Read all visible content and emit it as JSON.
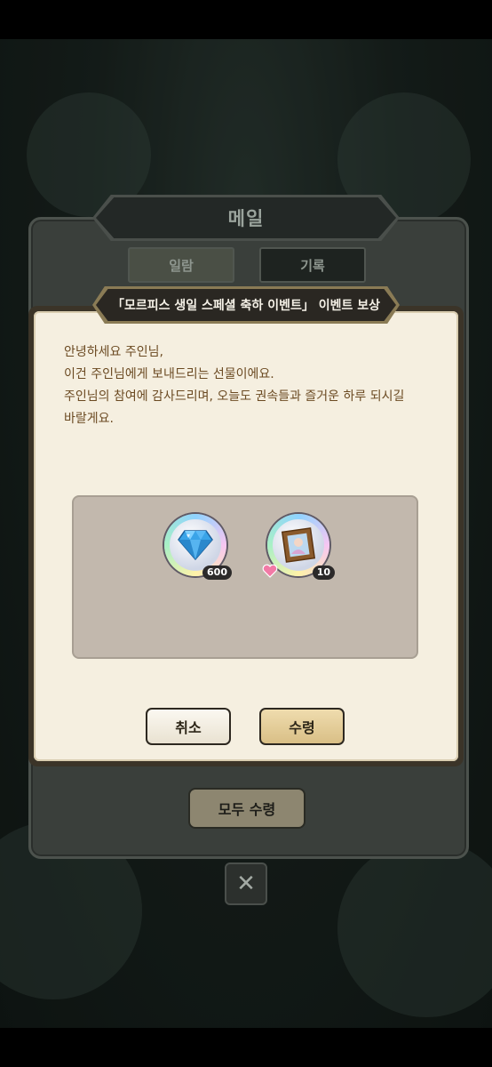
{
  "mail": {
    "title": "메일",
    "tabs": [
      {
        "label": "일람",
        "active": true
      },
      {
        "label": "기록",
        "active": false
      }
    ],
    "claim_all_label": "모두 수령",
    "close_glyph": "✕"
  },
  "dialog": {
    "title": "「모르피스 생일 스페셜 축하 이벤트」 이벤트 보상",
    "message_lines": [
      "안녕하세요 주인님,",
      "이건 주인님에게 보내드리는 선물이에요.",
      "주인님의 참여에 감사드리며, 오늘도 권속들과 즐거운 하루 되시길",
      "바랄게요."
    ],
    "rewards": [
      {
        "icon": "diamond-gem-icon",
        "count": "600"
      },
      {
        "icon": "portrait-frame-icon",
        "count": "10",
        "affection_icon": "heart-icon"
      }
    ],
    "cancel_label": "취소",
    "confirm_label": "수령"
  },
  "colors": {
    "message_text": "#6b4a22",
    "dialog_bg": "#f5efe0",
    "reward_box": "#c2b8ad",
    "confirm_button": "#e3cb93"
  }
}
